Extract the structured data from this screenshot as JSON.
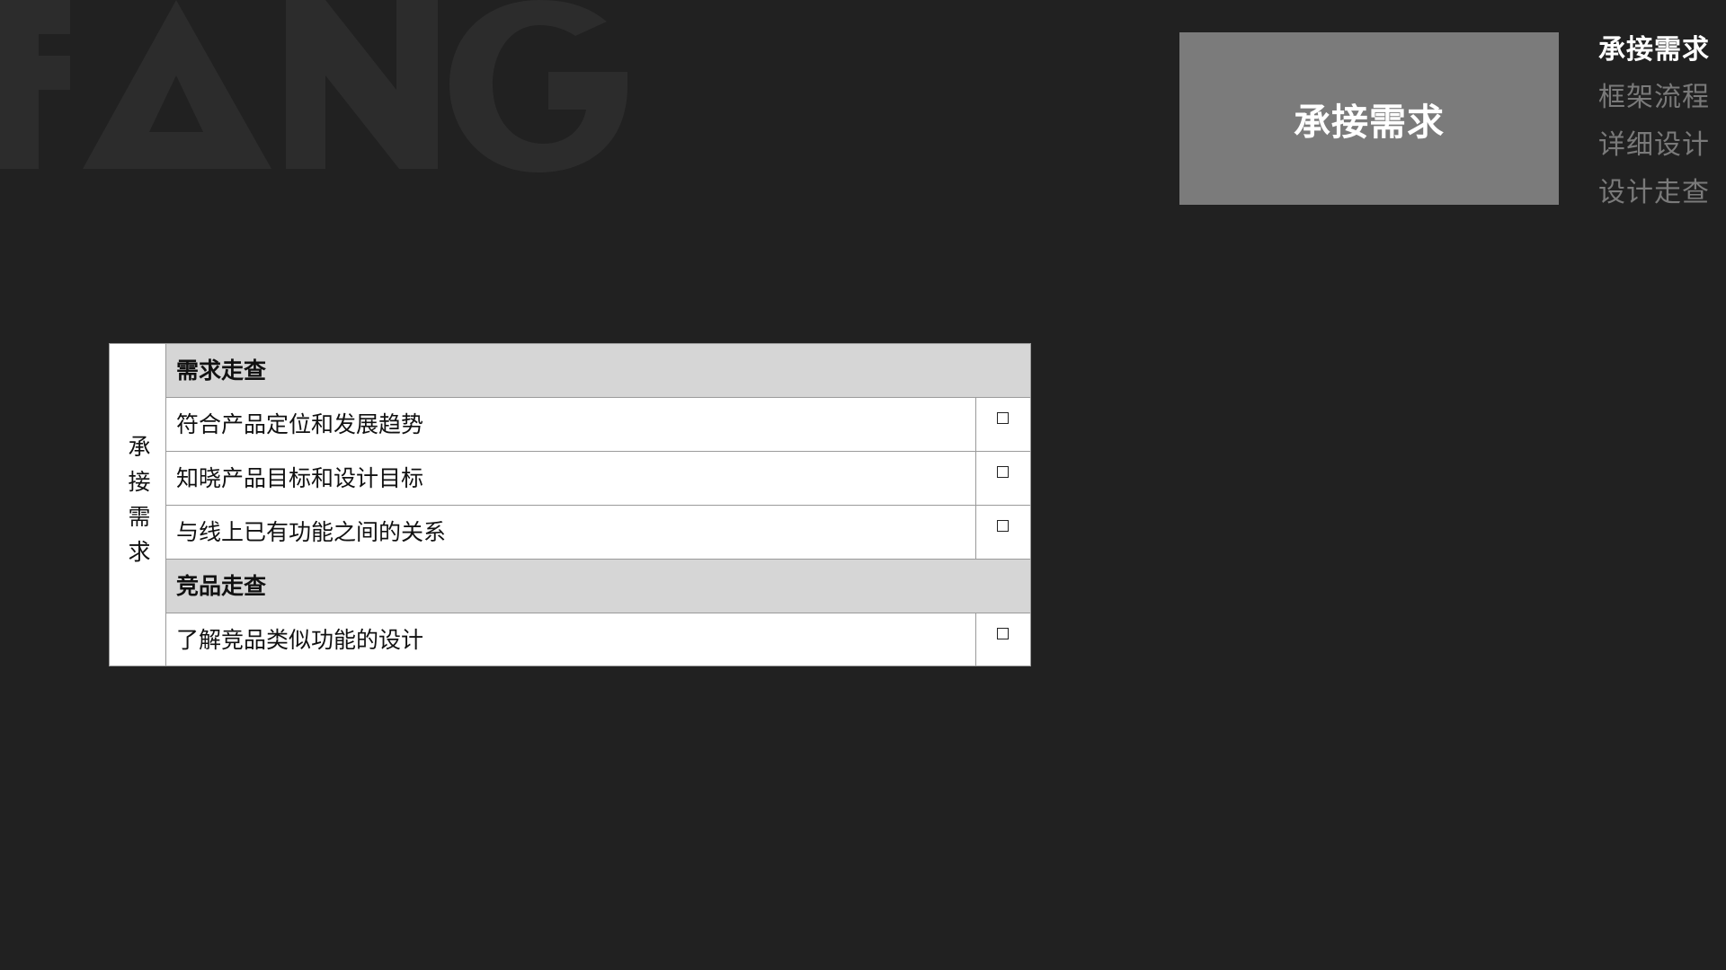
{
  "watermark": {
    "text": "FANG",
    "color": "#2c2c2c"
  },
  "section_card": {
    "title": "承接需求",
    "background": "#7b7b7b"
  },
  "nav": {
    "items": [
      {
        "label": "承接需求",
        "active": true
      },
      {
        "label": "框架流程",
        "active": false
      },
      {
        "label": "详细设计",
        "active": false
      },
      {
        "label": "设计走查",
        "active": false
      }
    ]
  },
  "checklist": {
    "category": "承接需求",
    "groups": [
      {
        "title": "需求走查",
        "items": [
          {
            "label": "符合产品定位和发展趋势",
            "checked": false
          },
          {
            "label": "知晓产品目标和设计目标",
            "checked": false
          },
          {
            "label": "与线上已有功能之间的关系",
            "checked": false
          }
        ]
      },
      {
        "title": "竞品走查",
        "items": [
          {
            "label": "了解竞品类似功能的设计",
            "checked": false
          }
        ]
      }
    ]
  },
  "colors": {
    "background": "#212121",
    "nav_inactive": "#7a7a7a",
    "nav_active": "#ffffff",
    "group_row": "#d6d6d6"
  }
}
